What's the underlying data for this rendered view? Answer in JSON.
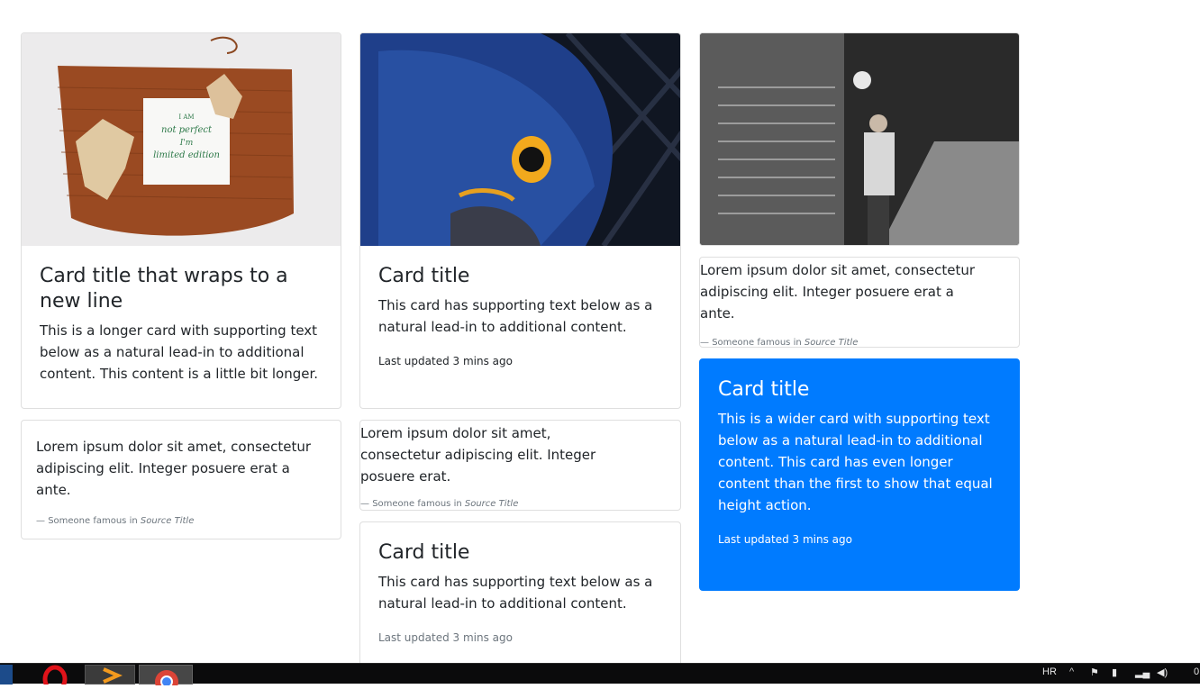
{
  "cards": {
    "knit": {
      "title": "Card title that wraps to a new line",
      "text": "This is a longer card with supporting text below as a natural lead-in to additional content. This content is a little bit longer.",
      "note_lines": [
        "I AM",
        "not perfect",
        "I'm",
        "limited edition"
      ]
    },
    "quote_left": {
      "text": "Lorem ipsum dolor sit amet, consectetur adipiscing elit. Integer posuere erat a ante.",
      "footer_prefix": "Someone famous in",
      "footer_source": "Source Title"
    },
    "parrot": {
      "title": "Card title",
      "text": "This card has supporting text below as a natural lead-in to additional content.",
      "meta": "Last updated 3 mins ago"
    },
    "quote_mid": {
      "text": "Lorem ipsum dolor sit amet, consectetur adipiscing elit. Integer posuere erat.",
      "footer_prefix": "Someone famous in",
      "footer_source": "Source Title"
    },
    "plain_mid": {
      "title": "Card title",
      "text": "This card has supporting text below as a natural lead-in to additional content.",
      "meta": "Last updated 3 mins ago"
    },
    "street_quote": {
      "text": "Lorem ipsum dolor sit amet, consectetur adipiscing elit. Integer posuere erat a ante.",
      "footer_prefix": "Someone famous in",
      "footer_source": "Source Title"
    },
    "primary": {
      "title": "Card title",
      "text": "This is a wider card with supporting text below as a natural lead-in to additional content. This card has even longer content than the first to show that equal height action.",
      "meta": "Last updated 3 mins ago"
    }
  },
  "taskbar": {
    "language": "HR",
    "clock_fragment": "0",
    "apps": [
      "file-explorer",
      "opera",
      "sublime-text",
      "chrome"
    ]
  },
  "colors": {
    "primary": "#007bff",
    "knit": "#9a4a22",
    "parrot": "#1f3f8a",
    "taskbar": "#0b0b0c"
  }
}
